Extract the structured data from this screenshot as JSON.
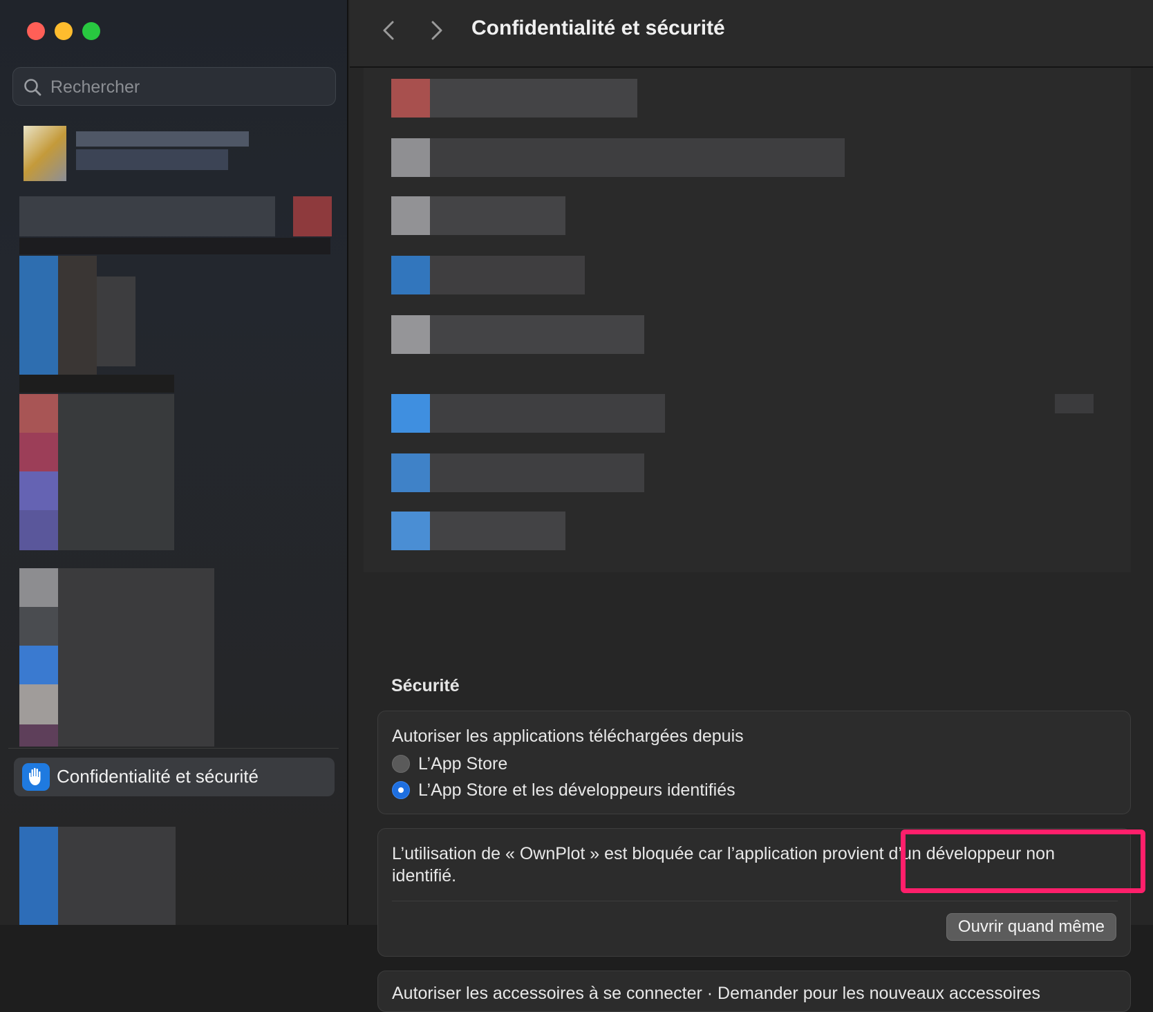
{
  "window": {
    "title": "Confidentialité et sécurité"
  },
  "sidebar": {
    "search": {
      "placeholder": "Rechercher",
      "value": ""
    },
    "selected_item": {
      "label": "Confidentialité et sécurité",
      "icon": "hand-raised-icon"
    }
  },
  "main": {
    "section_title": "Sécurité",
    "security": {
      "allow_label": "Autoriser les applications téléchargées depuis",
      "options": [
        {
          "label": "L’App Store",
          "selected": false
        },
        {
          "label": "L’App Store et les développeurs identifiés",
          "selected": true
        }
      ]
    },
    "blocked": {
      "message": "L’utilisation de « OwnPlot » est bloquée car l’application provient d’un développeur non identifié.",
      "open_button": "Ouvrir quand même"
    },
    "next_card_text": "Autoriser les accessoires à se connecter · Demander pour les nouveaux accessoires"
  },
  "colors": {
    "accent": "#1e6fe0",
    "highlight": "#ff1f6b",
    "sidebar_icon_bg": "#1f7ae0"
  }
}
